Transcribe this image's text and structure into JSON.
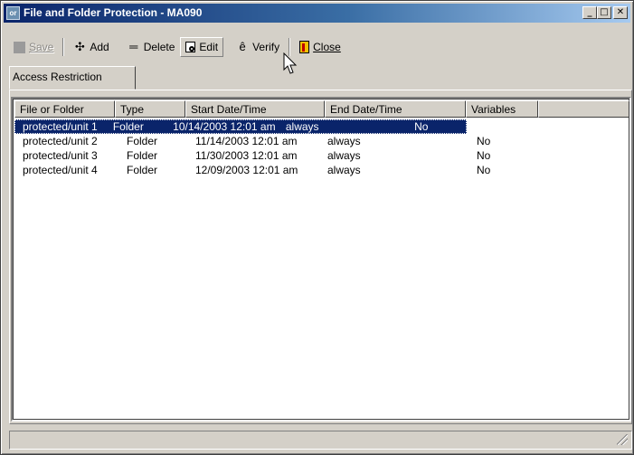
{
  "window": {
    "title": "File and Folder Protection - MA090",
    "icon_text": "or"
  },
  "caption_buttons": {
    "minimize": "_",
    "maximize": "□",
    "close": "✕"
  },
  "toolbar": {
    "save_label": "Save",
    "add_label": "Add",
    "delete_label": "Delete",
    "edit_label": "Edit",
    "verify_label": "Verify",
    "close_label": "Close"
  },
  "tabs": [
    {
      "label": "Access Restriction"
    }
  ],
  "table": {
    "columns": [
      "File or Folder",
      "Type",
      "Start Date/Time",
      "End Date/Time",
      "Variables",
      ""
    ],
    "rows": [
      {
        "file": "protected/unit 1",
        "type": "Folder",
        "start": "10/14/2003 12:01 am",
        "end": "always",
        "variables": "No",
        "selected": true
      },
      {
        "file": "protected/unit 2",
        "type": "Folder",
        "start": "11/14/2003 12:01 am",
        "end": "always",
        "variables": "No",
        "selected": false
      },
      {
        "file": "protected/unit 3",
        "type": "Folder",
        "start": "11/30/2003 12:01 am",
        "end": "always",
        "variables": "No",
        "selected": false
      },
      {
        "file": "protected/unit 4",
        "type": "Folder",
        "start": "12/09/2003 12:01 am",
        "end": "always",
        "variables": "No",
        "selected": false
      }
    ]
  },
  "colors": {
    "titlebar_start": "#0a246a",
    "titlebar_end": "#a6caf0",
    "selection": "#0a246a",
    "face": "#d4d0c8"
  }
}
